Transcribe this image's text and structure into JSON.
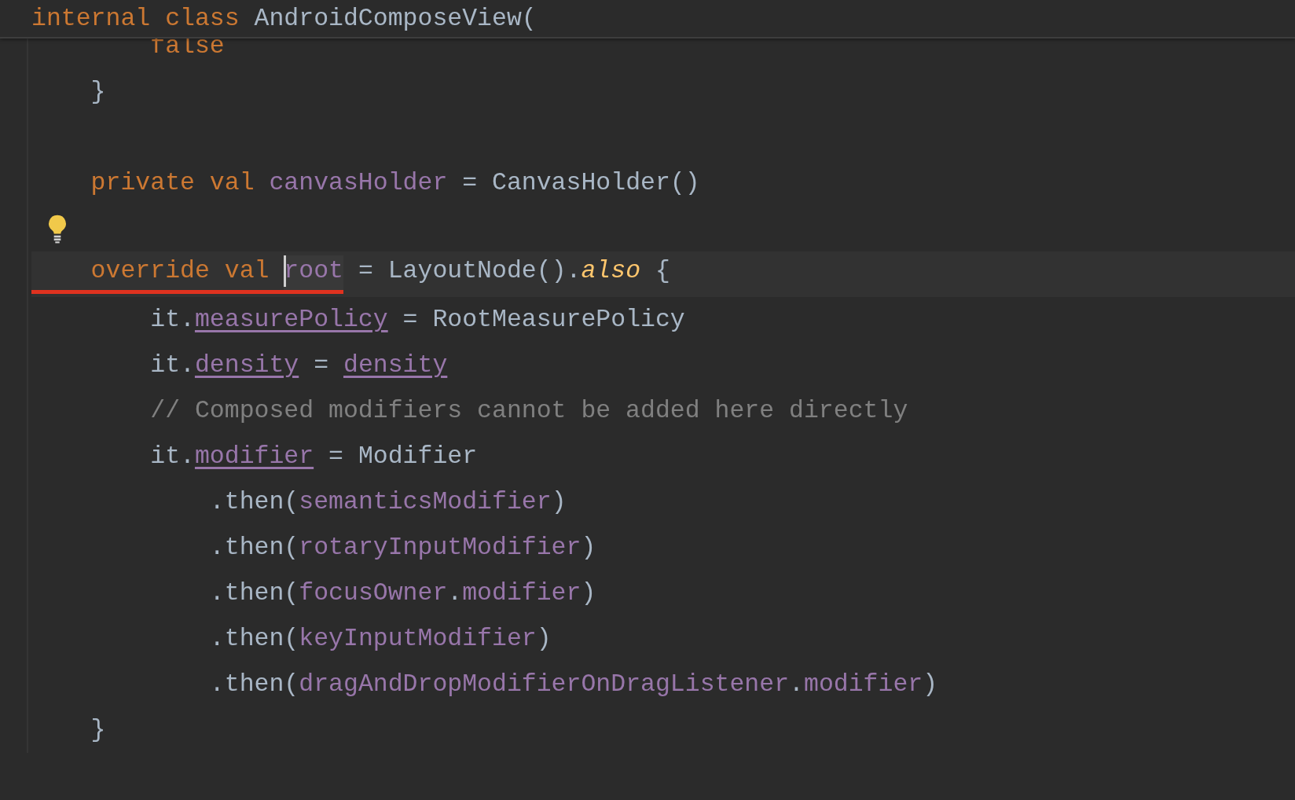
{
  "sticky_header": {
    "tokens": [
      {
        "kind": "kw",
        "t": "internal class "
      },
      {
        "kind": "plain",
        "t": "AndroidComposeView("
      }
    ]
  },
  "lines": [
    {
      "kind": "code",
      "tokens": [
        {
          "kind": "kw",
          "t": "        false"
        }
      ]
    },
    {
      "kind": "code",
      "tokens": [
        {
          "kind": "plain",
          "t": "    }"
        }
      ]
    },
    {
      "kind": "blank"
    },
    {
      "kind": "code",
      "tokens": [
        {
          "kind": "kw",
          "t": "    private val "
        },
        {
          "kind": "prop",
          "t": "canvasHolder"
        },
        {
          "kind": "plain",
          "t": " = CanvasHolder()"
        }
      ]
    },
    {
      "kind": "hint"
    },
    {
      "kind": "code",
      "current": true,
      "tokens": [
        {
          "kind": "kw",
          "t": "    override val ",
          "marked": true
        },
        {
          "kind": "prop",
          "t": "root",
          "marked": true,
          "highlighted": true,
          "caret": true
        },
        {
          "kind": "plain",
          "t": " = LayoutNode()."
        },
        {
          "kind": "fn-i",
          "t": "also"
        },
        {
          "kind": "plain",
          "t": " {"
        }
      ]
    },
    {
      "kind": "code",
      "tokens": [
        {
          "kind": "plain",
          "t": "        it."
        },
        {
          "kind": "prop-u",
          "t": "measurePolicy"
        },
        {
          "kind": "plain",
          "t": " = RootMeasurePolicy"
        }
      ]
    },
    {
      "kind": "code",
      "tokens": [
        {
          "kind": "plain",
          "t": "        it."
        },
        {
          "kind": "prop-u",
          "t": "density"
        },
        {
          "kind": "plain",
          "t": " = "
        },
        {
          "kind": "prop-u",
          "t": "density"
        }
      ]
    },
    {
      "kind": "code",
      "tokens": [
        {
          "kind": "comment",
          "t": "        // Composed modifiers cannot be added here directly"
        }
      ]
    },
    {
      "kind": "code",
      "tokens": [
        {
          "kind": "plain",
          "t": "        it."
        },
        {
          "kind": "prop-u",
          "t": "modifier"
        },
        {
          "kind": "plain",
          "t": " = Modifier"
        }
      ]
    },
    {
      "kind": "code",
      "tokens": [
        {
          "kind": "plain",
          "t": "            .then("
        },
        {
          "kind": "prop",
          "t": "semanticsModifier"
        },
        {
          "kind": "plain",
          "t": ")"
        }
      ]
    },
    {
      "kind": "code",
      "tokens": [
        {
          "kind": "plain",
          "t": "            .then("
        },
        {
          "kind": "prop",
          "t": "rotaryInputModifier"
        },
        {
          "kind": "plain",
          "t": ")"
        }
      ]
    },
    {
      "kind": "code",
      "tokens": [
        {
          "kind": "plain",
          "t": "            .then("
        },
        {
          "kind": "prop",
          "t": "focusOwner"
        },
        {
          "kind": "plain",
          "t": "."
        },
        {
          "kind": "prop",
          "t": "modifier"
        },
        {
          "kind": "plain",
          "t": ")"
        }
      ]
    },
    {
      "kind": "code",
      "tokens": [
        {
          "kind": "plain",
          "t": "            .then("
        },
        {
          "kind": "prop",
          "t": "keyInputModifier"
        },
        {
          "kind": "plain",
          "t": ")"
        }
      ]
    },
    {
      "kind": "code",
      "tokens": [
        {
          "kind": "plain",
          "t": "            .then("
        },
        {
          "kind": "prop",
          "t": "dragAndDropModifierOnDragListener"
        },
        {
          "kind": "plain",
          "t": "."
        },
        {
          "kind": "prop",
          "t": "modifier"
        },
        {
          "kind": "plain",
          "t": ")"
        }
      ]
    },
    {
      "kind": "code",
      "tokens": [
        {
          "kind": "plain",
          "t": "    }"
        }
      ]
    }
  ]
}
